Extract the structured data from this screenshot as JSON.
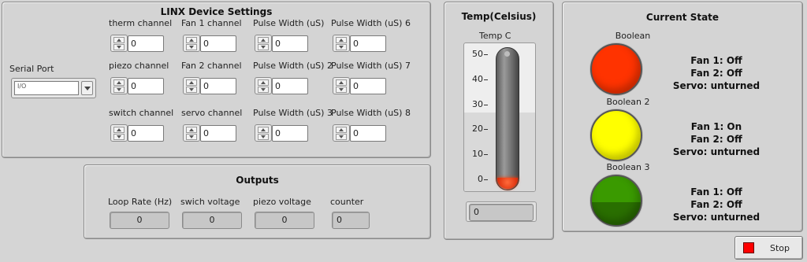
{
  "linx": {
    "title": "LINX Device Settings",
    "serial_port": {
      "label": "Serial Port",
      "value": "",
      "io_glyph": "I/O"
    },
    "columns": [
      [
        {
          "label": "therm  channel",
          "value": "0"
        },
        {
          "label": "piezo  channel",
          "value": "0"
        },
        {
          "label": "switch channel",
          "value": "0"
        }
      ],
      [
        {
          "label": "Fan 1 channel",
          "value": "0"
        },
        {
          "label": "Fan 2 channel",
          "value": "0"
        },
        {
          "label": "servo  channel",
          "value": "0"
        }
      ],
      [
        {
          "label": "Pulse Width (uS)",
          "value": "0"
        },
        {
          "label": "Pulse Width (uS) 2",
          "value": "0"
        },
        {
          "label": "Pulse Width (uS) 3",
          "value": "0"
        }
      ],
      [
        {
          "label": "Pulse Width (uS) 6",
          "value": "0"
        },
        {
          "label": "Pulse Width (uS) 7",
          "value": "0"
        },
        {
          "label": "Pulse Width (uS) 8",
          "value": "0"
        }
      ]
    ]
  },
  "outputs": {
    "title": "Outputs",
    "items": [
      {
        "label": "Loop Rate (Hz)",
        "value": "0"
      },
      {
        "label": "swich voltage",
        "value": "0"
      },
      {
        "label": "piezo voltage",
        "value": "0"
      },
      {
        "label": "counter",
        "value": "0"
      }
    ]
  },
  "temp": {
    "title": "Temp(Celsius)",
    "label": "Temp C",
    "ticks": [
      "50",
      "40",
      "30",
      "20",
      "10",
      "0"
    ],
    "value": 0,
    "readout": "0"
  },
  "state": {
    "title": "Current State",
    "items": [
      {
        "label": "Boolean",
        "color": "#ff3300",
        "lines": [
          "Fan 1: Off",
          "Fan 2: Off",
          "Servo: unturned"
        ]
      },
      {
        "label": "Boolean 2",
        "color": "#ffff00",
        "lines": [
          "Fan 1: On",
          "Fan 2: Off",
          "Servo: unturned"
        ]
      },
      {
        "label": "Boolean 3",
        "color": "#3a9a00",
        "lines": [
          "Fan 1: Off",
          "Fan 2: Off",
          "Servo: unturned"
        ]
      }
    ]
  },
  "stop": {
    "label": "Stop",
    "color": "#ff0000"
  }
}
